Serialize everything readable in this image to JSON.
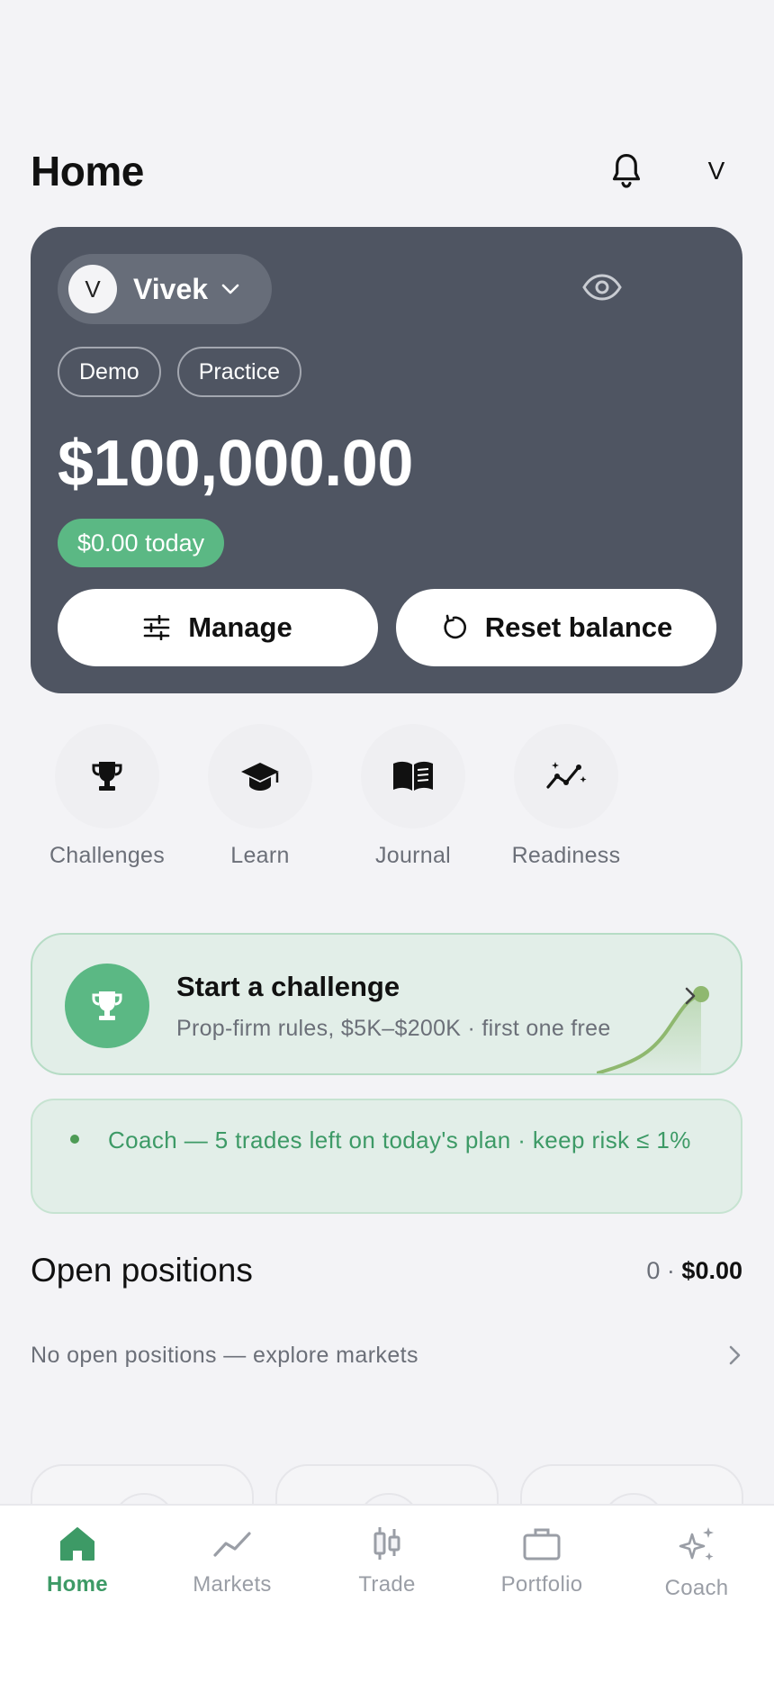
{
  "header": {
    "title": "Home",
    "avatar_initial": "V"
  },
  "account": {
    "avatar_initial": "V",
    "name": "Vivek",
    "tags": [
      "Demo",
      "Practice"
    ],
    "balance": "$100,000.00",
    "today_change": "$0.00 today",
    "manage_label": "Manage",
    "reset_label": "Reset balance"
  },
  "shortcuts": [
    {
      "label": "Challenges",
      "icon": "trophy-icon"
    },
    {
      "label": "Learn",
      "icon": "graduation-cap-icon"
    },
    {
      "label": "Journal",
      "icon": "book-icon"
    },
    {
      "label": "Readiness",
      "icon": "trend-chart-icon"
    }
  ],
  "challenge": {
    "title": "Start a challenge",
    "subtitle": "Prop-firm rules, $5K–$200K · first one free"
  },
  "coach_tip": "Coach — 5 trades left on today's plan · keep risk ≤ 1%",
  "positions": {
    "title": "Open positions",
    "count": "0 · ",
    "total": "$0.00",
    "empty_text": "No open positions — explore markets"
  },
  "tabs": [
    {
      "label": "Home",
      "active": true
    },
    {
      "label": "Markets",
      "active": false
    },
    {
      "label": "Trade",
      "active": false
    },
    {
      "label": "Portfolio",
      "active": false
    },
    {
      "label": "Coach",
      "active": false
    }
  ],
  "colors": {
    "background": "#f3f3f6",
    "card": "#4f5562",
    "accent_green": "#5bb884",
    "active_tab": "#3d9a66",
    "inactive_tab": "#9a9ea6"
  }
}
